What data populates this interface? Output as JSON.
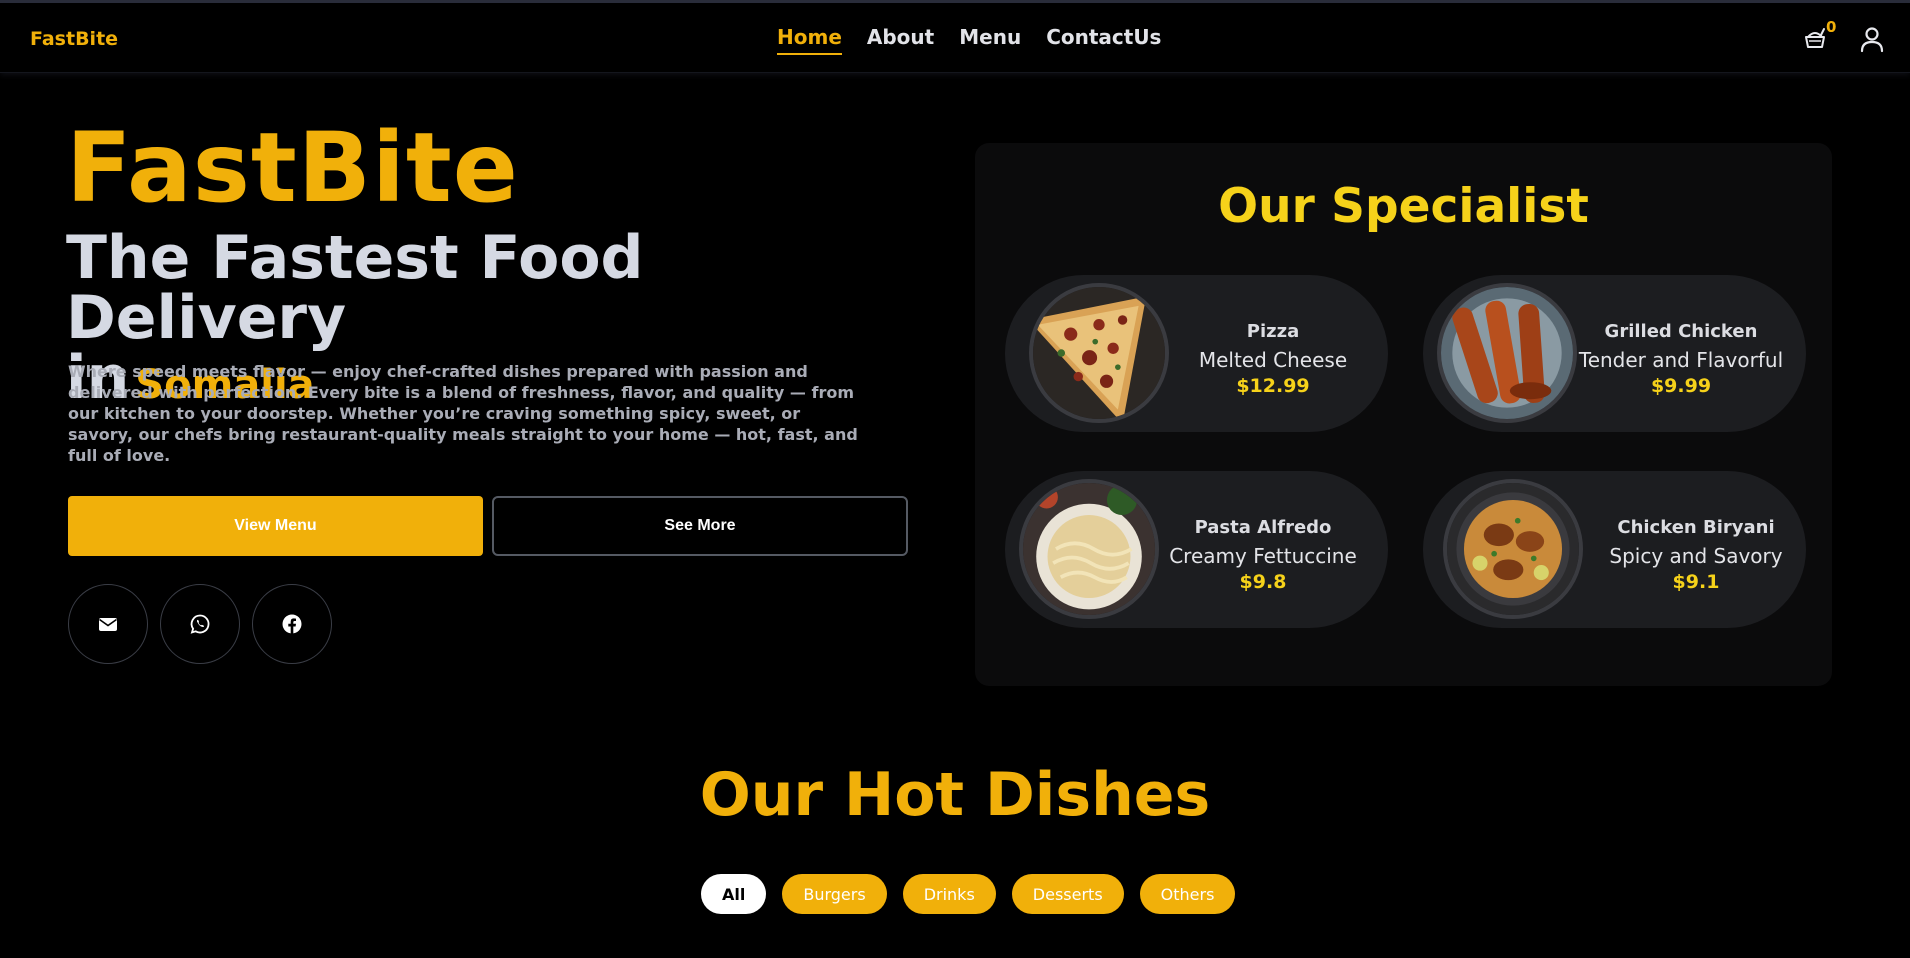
{
  "brand": "FastBite",
  "nav": {
    "links": [
      {
        "label": "Home",
        "active": true
      },
      {
        "label": "About",
        "active": false
      },
      {
        "label": "Menu",
        "active": false
      },
      {
        "label": "ContactUs",
        "active": false
      }
    ],
    "cart_count": "0",
    "cart_icon": "cart-icon",
    "user_icon": "user-icon"
  },
  "hero": {
    "title": "FastBite",
    "subtitle_line1": "The Fastest Food Delivery",
    "subtitle_in": "in",
    "location": "Somalia",
    "description": "Where speed meets flavor — enjoy chef-crafted dishes prepared with passion and delivered with perfection. Every bite is a blend of freshness, flavor, and quality — from our kitchen to your doorstep. Whether you’re craving something spicy, sweet, or savory, our chefs bring restaurant-quality meals straight to your home — hot, fast, and full of love.",
    "primary_button": "View Menu",
    "secondary_button": "See More",
    "socials": [
      "envelope-icon",
      "whatsapp-icon",
      "facebook-icon"
    ]
  },
  "specialist": {
    "title": "Our Specialist",
    "items": [
      {
        "name": "Pizza",
        "desc": "Melted Cheese",
        "price": "$12.99"
      },
      {
        "name": "Grilled Chicken",
        "desc": "Tender and Flavorful",
        "price": "$9.99"
      },
      {
        "name": "Pasta Alfredo",
        "desc": "Creamy Fettuccine",
        "price": "$9.8"
      },
      {
        "name": "Chicken Biryani",
        "desc": "Spicy and Savory",
        "price": "$9.1"
      }
    ]
  },
  "hot_dishes": {
    "title": "Our Hot Dishes",
    "filters": [
      {
        "label": "All",
        "active": true
      },
      {
        "label": "Burgers",
        "active": false
      },
      {
        "label": "Drinks",
        "active": false
      },
      {
        "label": "Desserts",
        "active": false
      },
      {
        "label": "Others",
        "active": false
      }
    ]
  },
  "colors": {
    "accent": "#f1b00a",
    "specialist_accent": "#f6d21a",
    "background": "#000000",
    "card": "#1c1d20"
  }
}
